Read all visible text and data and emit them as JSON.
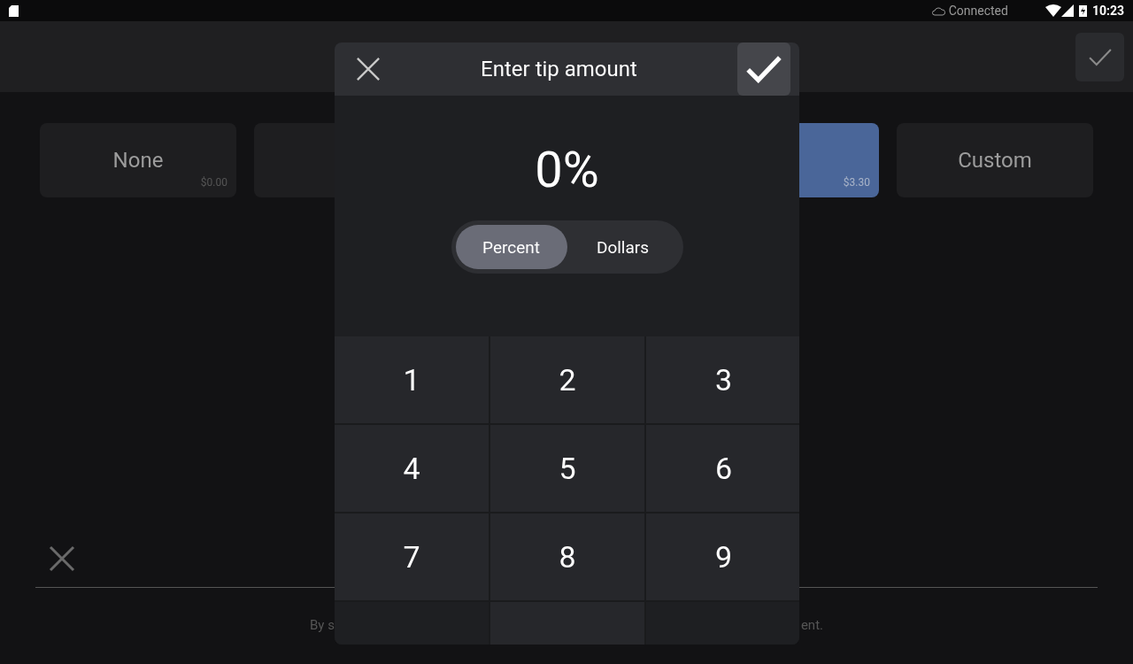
{
  "status_bar": {
    "connection": "Connected",
    "time": "10:23"
  },
  "tip_options": [
    {
      "label": "None",
      "amount": "$0.00",
      "selected": false
    },
    {
      "selected": false
    },
    {
      "amount": "$3.30",
      "selected": true
    },
    {
      "label": "Custom",
      "selected": false
    }
  ],
  "footer": {
    "text_left": "By s",
    "text_right": "ent."
  },
  "dialog": {
    "title": "Enter tip amount",
    "display": "0%",
    "modes": [
      {
        "label": "Percent",
        "selected": true
      },
      {
        "label": "Dollars",
        "selected": false
      }
    ],
    "keys": [
      {
        "label": "1",
        "kind": "digit"
      },
      {
        "label": "2",
        "kind": "digit"
      },
      {
        "label": "3",
        "kind": "digit"
      },
      {
        "label": "4",
        "kind": "digit"
      },
      {
        "label": "5",
        "kind": "digit"
      },
      {
        "label": "6",
        "kind": "digit"
      },
      {
        "label": "7",
        "kind": "digit"
      },
      {
        "label": "8",
        "kind": "digit"
      },
      {
        "label": "9",
        "kind": "digit"
      },
      {
        "kind": "blank"
      },
      {
        "kind": "digit"
      },
      {
        "kind": "blank"
      }
    ]
  }
}
